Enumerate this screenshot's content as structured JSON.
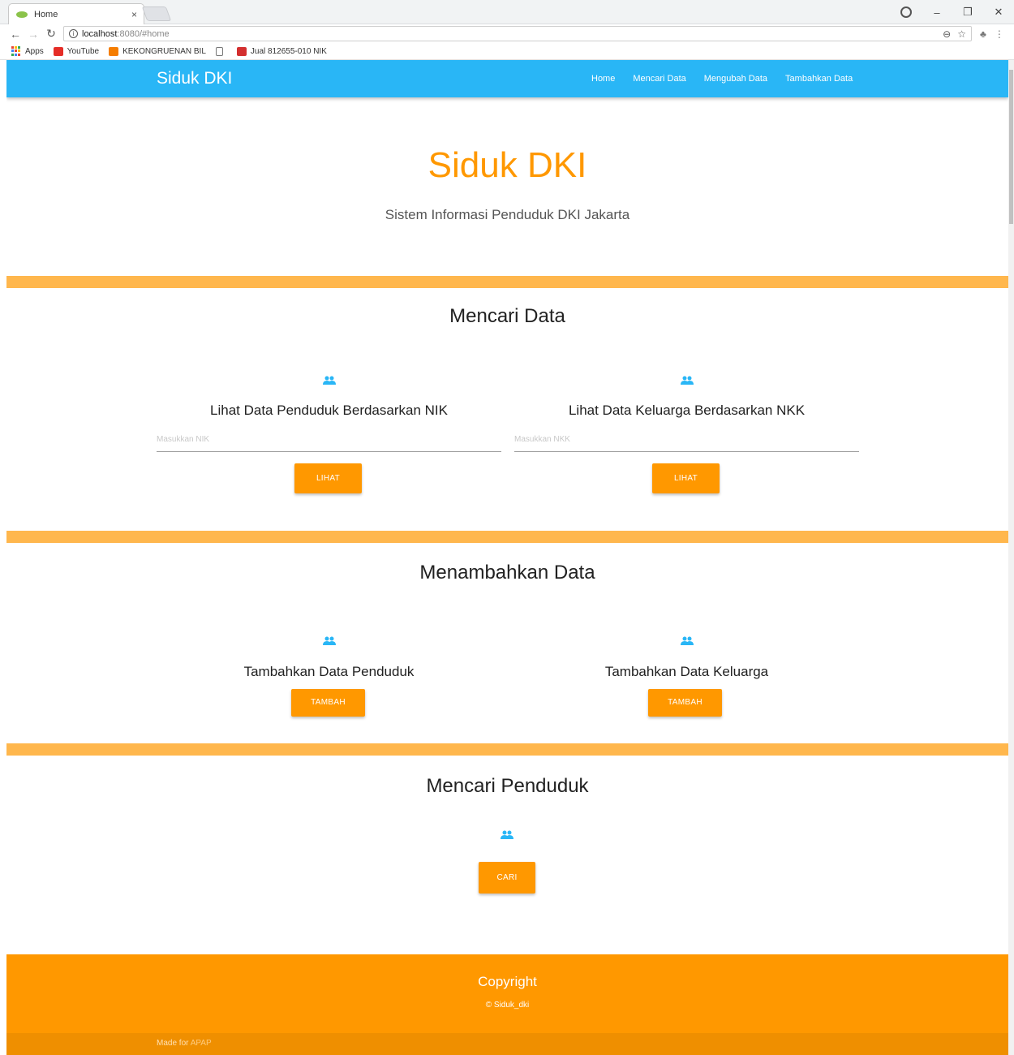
{
  "browser": {
    "tab_title": "Home",
    "tab_close": "×",
    "url_host": "localhost",
    "url_rest": ":8080/#home",
    "window_controls": [
      "–",
      "❐",
      "✕"
    ],
    "bookmarks": [
      {
        "label": "Apps",
        "icon": "apps-icon"
      },
      {
        "label": "YouTube",
        "icon": "youtube-icon"
      },
      {
        "label": "KEKONGRUENAN BIL",
        "icon": "blogger-icon"
      },
      {
        "label": "",
        "icon": "page-icon"
      },
      {
        "label": "Jual 812655-010 NIK",
        "icon": "jd-icon"
      }
    ]
  },
  "navbar": {
    "brand": "Siduk DKI",
    "links": [
      "Home",
      "Mencari Data",
      "Mengubah Data",
      "Tambahkan Data"
    ]
  },
  "hero": {
    "title": "Siduk DKI",
    "subtitle": "Sistem Informasi Penduduk DKI Jakarta"
  },
  "search_section": {
    "title": "Mencari Data",
    "cards": [
      {
        "title": "Lihat Data Penduduk Berdasarkan NIK",
        "placeholder": "Masukkan NIK",
        "button": "LIHAT"
      },
      {
        "title": "Lihat Data Keluarga Berdasarkan NKK",
        "placeholder": "Masukkan NKK",
        "button": "LIHAT"
      }
    ]
  },
  "add_section": {
    "title": "Menambahkan Data",
    "cards": [
      {
        "title": "Tambahkan Data Penduduk",
        "button": "TAMBAH"
      },
      {
        "title": "Tambahkan Data Keluarga",
        "button": "TAMBAH"
      }
    ]
  },
  "find_section": {
    "title": "Mencari Penduduk",
    "button": "CARI"
  },
  "footer": {
    "title": "Copyright",
    "copy": "© Siduk_dki",
    "made_for_prefix": "Made for ",
    "made_for_link": "APAP"
  },
  "colors": {
    "navbar": "#29b6f6",
    "accent": "#ff9800",
    "divider": "#ffb74d",
    "icon": "#29b6f6"
  }
}
